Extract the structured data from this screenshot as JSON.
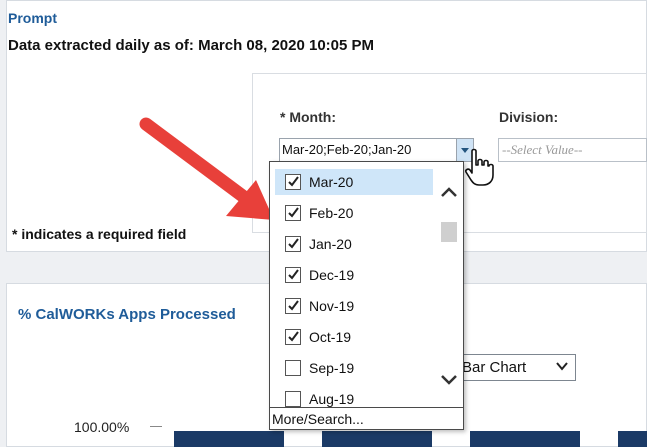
{
  "prompt": {
    "label": "Prompt",
    "extracted_text": "Data extracted daily as of: March 08, 2020 10:05 PM",
    "month_label": "* Month:",
    "month_value": "Mar-20;Feb-20;Jan-20",
    "division_label": "Division:",
    "division_placeholder": "--Select Value--",
    "required_note": "* indicates a required field"
  },
  "month_dropdown": {
    "items": [
      {
        "label": "Mar-20",
        "checked": true
      },
      {
        "label": "Feb-20",
        "checked": true
      },
      {
        "label": "Jan-20",
        "checked": true
      },
      {
        "label": "Dec-19",
        "checked": true
      },
      {
        "label": "Nov-19",
        "checked": true
      },
      {
        "label": "Oct-19",
        "checked": true
      },
      {
        "label": "Sep-19",
        "checked": false
      },
      {
        "label": "Aug-19",
        "checked": false
      }
    ],
    "more_search": "More/Search..."
  },
  "chart": {
    "title": "% CalWORKs Apps Processed",
    "type_select": "Bar Chart",
    "ytick_top": "100.00%"
  },
  "colors": {
    "accent": "#1f5c99",
    "arrow": "#e8403a",
    "bar": "#1b3a66",
    "selected": "#cfe6f9"
  }
}
